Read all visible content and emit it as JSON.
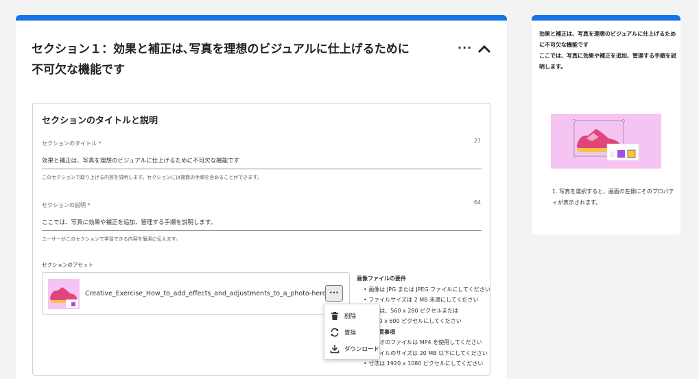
{
  "section": {
    "title": "セクション１：効果と補正は､写真を理想のビジュアルに仕上げるために不可欠な機能です",
    "more_label": "···"
  },
  "panel": {
    "heading": "セクションのタイトルと説明",
    "title_field": {
      "label": "セクションのタイトル *",
      "count": "27",
      "value": "効果と補正は、写真を理想のビジュアルに仕上げるために不可欠な機能です",
      "help": "このセクションで取り上げる内容を説明します。セクションには複数の手順を含めることができます。"
    },
    "desc_field": {
      "label": "セクションの説明 *",
      "count": "64",
      "value": "ここでは、写真に効果や補正を追加、管理する手順を説明します。",
      "help": "ユーザーがこのセクションで学習できる内容を簡潔に伝えます。"
    },
    "assets_label": "セクションのアセット",
    "asset": {
      "file_name": "Creative_Exercise_How_to_add_effects_and_adjustments_to_a_photo-hero.jpg",
      "more_label": "···"
    }
  },
  "requirements": {
    "image_heading": "画像ファイルの要件",
    "image_items": [
      "画像は JPG または JPEG ファイルにしてください",
      "ファイルサイズは 2 MB 未満にしてください",
      "寸法は、560 x 280 ピクセルまたは",
      "1200 x 600 ピクセルにしてください"
    ],
    "video_heading": "ビデオ推奨事項",
    "video_items": [
      "ビデオのファイルは MP4 を使用してください",
      "ファイルのサイズは 20 MB 以下にしてください",
      "寸法は 1920 x 1080 ピクセルにしてください"
    ]
  },
  "context_menu": {
    "items": [
      {
        "label": "削除",
        "icon": "trash-icon"
      },
      {
        "label": "置換",
        "icon": "refresh-icon"
      },
      {
        "label": "ダウンロード",
        "icon": "download-icon"
      }
    ]
  },
  "side": {
    "description": "効果と補正は、写真を理想のビジュアルに仕上げるために不可欠な機能です\nここでは、写真に効果や補正を追加、管理する手順を説明します。",
    "step": "1. 写真を選択すると、画面の左側にそのプロパティが表示されます。"
  },
  "colors": {
    "accent": "#1473e6",
    "thumb_bg": "#f6c4f3",
    "shoe_pink": "#e0457b",
    "shoe_yellow": "#f5c542"
  }
}
